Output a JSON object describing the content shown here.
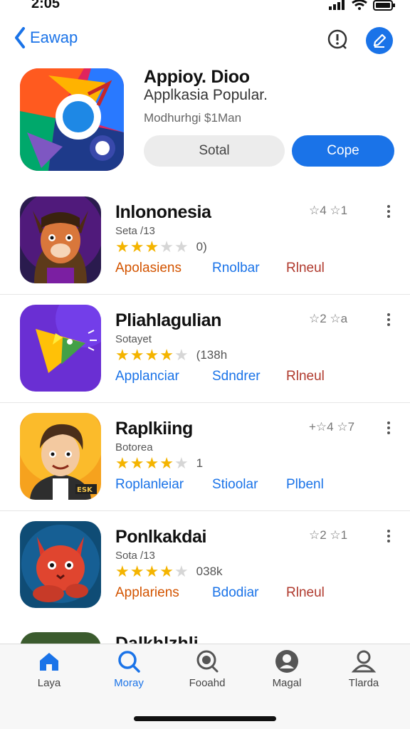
{
  "status_bar": {
    "time": "2:05"
  },
  "nav": {
    "back_label": "Eawap"
  },
  "featured": {
    "title": "Appioy. Dioo",
    "subtitle": "Applkasia Popular.",
    "meta": "Modhurhgi $1Man",
    "secondary_button": "Sotal",
    "primary_button": "Cope"
  },
  "apps": [
    {
      "name": "Inlononesia",
      "subtitle": "Seta /13",
      "rating": 3,
      "rating_count": "0)",
      "tag_a": "Apolasiens",
      "tag_b": "Rnolbar",
      "tag_c": "Rlneul",
      "side": "☆4 ☆1"
    },
    {
      "name": "Pliahlagulian",
      "subtitle": "Sotayet",
      "rating": 4,
      "rating_count": "(138h",
      "tag_a": "Applanciar",
      "tag_b": "Sdndrer",
      "tag_c": "Rlneul",
      "side": "☆2 ☆a"
    },
    {
      "name": "Raplkiing",
      "subtitle": "Botorea",
      "rating": 4,
      "rating_count": "1",
      "tag_a": "Roplanleiar",
      "tag_b": "Stioolar",
      "tag_c": "Plbenl",
      "side": "+☆4 ☆7"
    },
    {
      "name": "Ponlkakdai",
      "subtitle": "Sota /13",
      "rating": 4,
      "rating_count": "038k",
      "tag_a": "Applariens",
      "tag_b": "Bdodiar",
      "tag_c": "Rlneul",
      "side": "☆2 ☆1"
    }
  ],
  "peek_row": {
    "name": "Dalkhlzhli"
  },
  "tabs": [
    {
      "label": "Laya",
      "icon": "home-icon",
      "active": true
    },
    {
      "label": "Moray",
      "icon": "search-icon",
      "active": true
    },
    {
      "label": "Fooahd",
      "icon": "search-badge-icon",
      "active": false
    },
    {
      "label": "Magal",
      "icon": "user-circle-icon",
      "active": false
    },
    {
      "label": "Tlarda",
      "icon": "profile-icon",
      "active": false
    }
  ],
  "colors": {
    "accent": "#1a73e8",
    "star": "#f4b400",
    "tag_orange": "#d35400",
    "tag_red": "#b03a2e"
  }
}
